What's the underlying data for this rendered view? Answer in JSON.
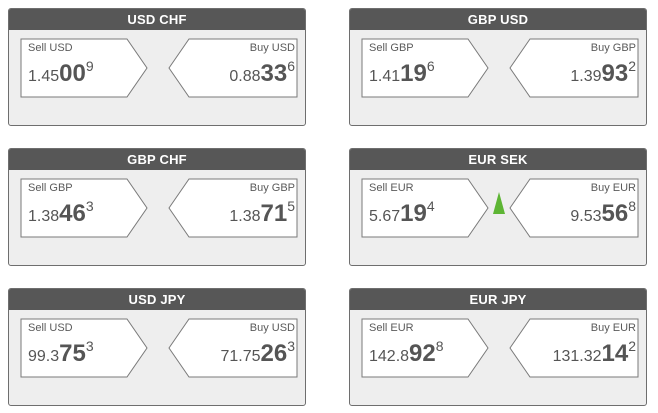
{
  "tiles": [
    {
      "pair": "USD CHF",
      "sell_label": "Sell USD",
      "sell": {
        "small": "1.45",
        "big": "00",
        "sup": "9"
      },
      "buy_label": "Buy USD",
      "buy": {
        "small": "0.88",
        "big": "33",
        "sup": "6"
      },
      "trend": ""
    },
    {
      "pair": "GBP USD",
      "sell_label": "Sell GBP",
      "sell": {
        "small": "1.41",
        "big": "19",
        "sup": "6"
      },
      "buy_label": "Buy GBP",
      "buy": {
        "small": "1.39",
        "big": "93",
        "sup": "2"
      },
      "trend": ""
    },
    {
      "pair": "GBP CHF",
      "sell_label": "Sell GBP",
      "sell": {
        "small": "1.38",
        "big": "46",
        "sup": "3"
      },
      "buy_label": "Buy GBP",
      "buy": {
        "small": "1.38",
        "big": "71",
        "sup": "5"
      },
      "trend": ""
    },
    {
      "pair": "EUR SEK",
      "sell_label": "Sell EUR",
      "sell": {
        "small": "5.67",
        "big": "19",
        "sup": "4"
      },
      "buy_label": "Buy EUR",
      "buy": {
        "small": "9.53",
        "big": "56",
        "sup": "8"
      },
      "trend": "up"
    },
    {
      "pair": "USD JPY",
      "sell_label": "Sell USD",
      "sell": {
        "small": "99.3",
        "big": "75",
        "sup": "3"
      },
      "buy_label": "Buy USD",
      "buy": {
        "small": "71.75",
        "big": "26",
        "sup": "3"
      },
      "trend": ""
    },
    {
      "pair": "EUR JPY",
      "sell_label": "Sell EUR",
      "sell": {
        "small": "142.8",
        "big": "92",
        "sup": "8"
      },
      "buy_label": "Buy EUR",
      "buy": {
        "small": "131.32",
        "big": "14",
        "sup": "2"
      },
      "trend": ""
    }
  ],
  "colors": {
    "header_bg": "#575757",
    "panel_bg": "#eeeeee",
    "quote_bg": "#ffffff",
    "text": "#555555",
    "trend_up": "#5db534"
  },
  "icons": {
    "trend_up": "up-arrow-icon"
  }
}
